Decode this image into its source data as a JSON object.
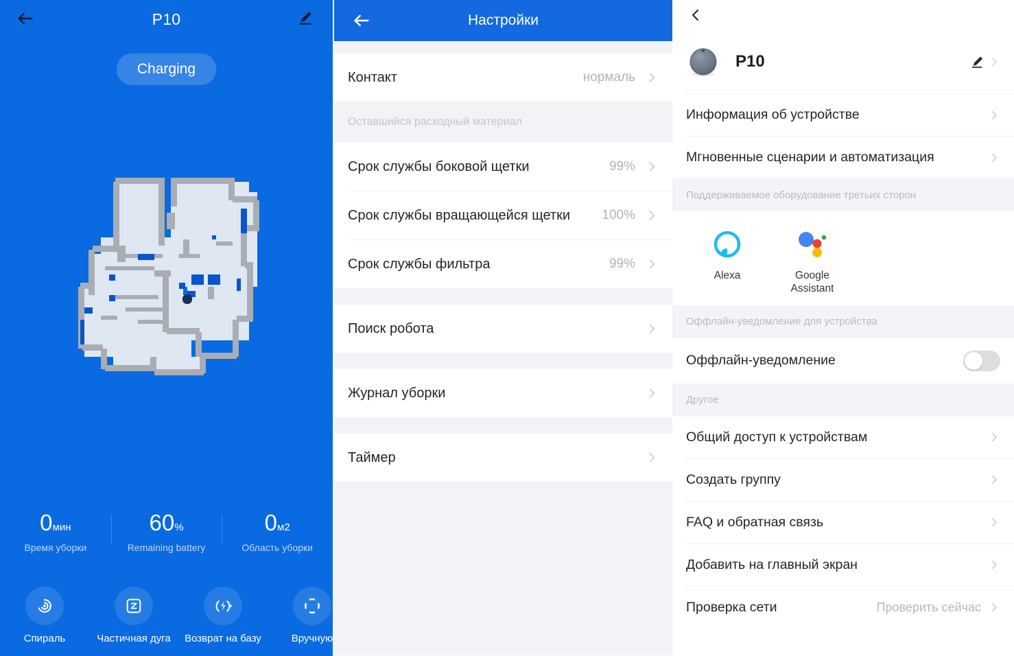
{
  "colors": {
    "brand_blue": "#0a6ae1",
    "header_blue": "#1469e0",
    "map_wall": "#a9adb4",
    "map_floor": "#dfe7f3",
    "muted_text": "#b2b3bb",
    "alexa_cyan": "#21bbed",
    "google_blue": "#4285f4",
    "google_red": "#ea4335",
    "google_yellow": "#fbbc05",
    "google_green": "#34a853"
  },
  "panel1": {
    "back_icon": "arrow-left-icon",
    "title": "P10",
    "edit_icon": "pencil-icon",
    "status": "Charging",
    "stats": [
      {
        "value": "0",
        "unit": "мин",
        "label": "Время уборки"
      },
      {
        "value": "60",
        "unit": "%",
        "label": "Remaining battery"
      },
      {
        "value": "0",
        "unit": "м2",
        "label": "Область уборки"
      }
    ],
    "actions": [
      {
        "icon": "spiral-icon",
        "label": "Спираль"
      },
      {
        "icon": "partial-arc-icon",
        "label": "Частичная дуга"
      },
      {
        "icon": "charging-dock-icon",
        "label": "Возврат на базу"
      },
      {
        "icon": "manual-control-icon",
        "label": "Вручную"
      }
    ]
  },
  "panel2": {
    "back_icon": "arrow-left-icon",
    "title": "Настройки",
    "groups": [
      {
        "header": null,
        "rows": [
          {
            "label": "Контакт",
            "value": "нормаль",
            "chevron": true
          }
        ]
      },
      {
        "header": "Оставшийся расходный материал",
        "rows": [
          {
            "label": "Срок службы боковой щетки",
            "value": "99%",
            "chevron": true
          },
          {
            "label": "Срок службы вращающейся щетки",
            "value": "100%",
            "chevron": true
          },
          {
            "label": "Срок службы фильтра",
            "value": "99%",
            "chevron": true
          }
        ]
      },
      {
        "header": null,
        "rows": [
          {
            "label": "Поиск робота",
            "value": "",
            "chevron": true
          }
        ]
      },
      {
        "header": null,
        "rows": [
          {
            "label": "Журнал уборки",
            "value": "",
            "chevron": true
          }
        ]
      },
      {
        "header": null,
        "rows": [
          {
            "label": "Таймер",
            "value": "",
            "chevron": true
          }
        ]
      }
    ]
  },
  "panel3": {
    "back_icon": "chevron-left-icon",
    "device": {
      "avatar_icon": "robot-vacuum-icon",
      "name": "P10",
      "edit_icon": "pencil-icon",
      "chevron": true
    },
    "top_rows": [
      {
        "label": "Информация об устройстве",
        "value": "",
        "chevron": true
      },
      {
        "label": "Мгновенные сценарии и автоматизация",
        "value": "",
        "chevron": true
      }
    ],
    "third_party": {
      "header": "Поддерживаемое оборудование третьих сторон",
      "items": [
        {
          "icon": "alexa-icon",
          "label": "Alexa"
        },
        {
          "icon": "google-assistant-icon",
          "label": "Google\nAssistant"
        }
      ]
    },
    "offline": {
      "header": "Оффлайн-уведомление для устройства",
      "row_label": "Оффлайн-уведомление",
      "toggle_state": "off"
    },
    "other": {
      "header": "Другое",
      "rows": [
        {
          "label": "Общий доступ к устройствам",
          "value": "",
          "chevron": true
        },
        {
          "label": "Создать группу",
          "value": "",
          "chevron": true
        },
        {
          "label": "FAQ и обратная связь",
          "value": "",
          "chevron": true
        },
        {
          "label": "Добавить на главный экран",
          "value": "",
          "chevron": true
        },
        {
          "label": "Проверка сети",
          "value": "Проверить сейчас",
          "chevron": true
        }
      ]
    }
  }
}
